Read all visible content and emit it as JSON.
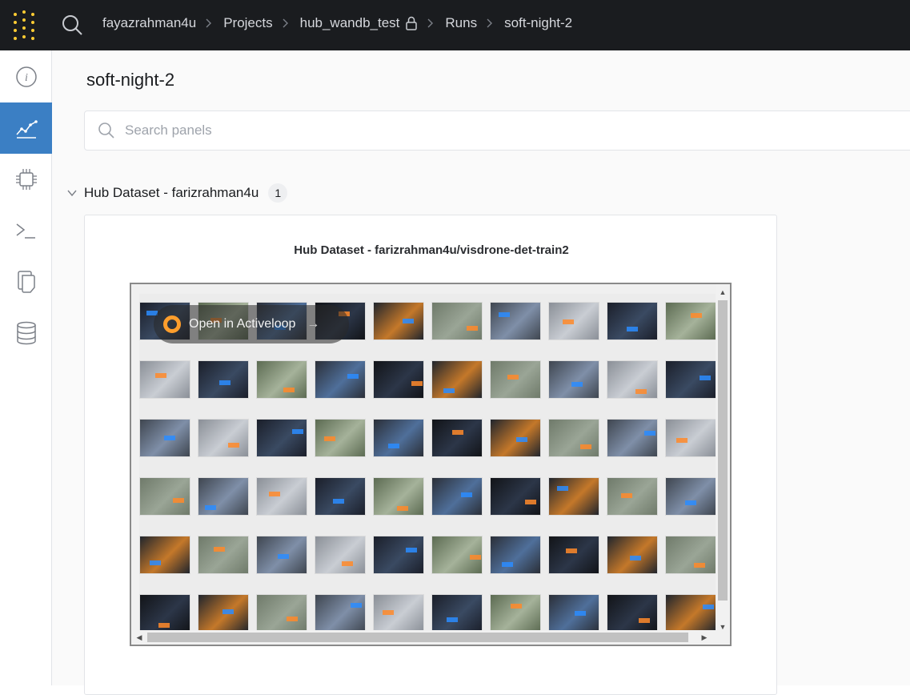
{
  "topbar": {
    "logo_icon": "wandb-dots-logo",
    "search_icon": "search-icon",
    "breadcrumbs": [
      "fayazrahman4u",
      "Projects",
      "hub_wandb_test",
      "Runs",
      "soft-night-2"
    ],
    "private_icon": "lock-icon",
    "colors": {
      "background": "#1a1c1f",
      "logo": "#ffcc33"
    }
  },
  "sidenav": {
    "items": [
      {
        "name": "overview",
        "icon": "info-icon",
        "active": false
      },
      {
        "name": "charts",
        "icon": "chart-line-icon",
        "active": true
      },
      {
        "name": "system",
        "icon": "chip-icon",
        "active": false
      },
      {
        "name": "logs",
        "icon": "terminal-icon",
        "active": false
      },
      {
        "name": "files",
        "icon": "files-icon",
        "active": false
      },
      {
        "name": "artifacts",
        "icon": "database-icon",
        "active": false
      }
    ],
    "active_color": "#3b7fc4"
  },
  "main": {
    "run_title": "soft-night-2",
    "search": {
      "placeholder": "Search panels",
      "value": ""
    },
    "section": {
      "title": "Hub Dataset - farizrahman4u",
      "count": "1"
    },
    "panel": {
      "title": "Hub Dataset - farizrahman4u/visdrone-det-train2",
      "open_button_label": "Open in Activeloop",
      "gallery_rows": 6,
      "gallery_cols": 10
    }
  }
}
